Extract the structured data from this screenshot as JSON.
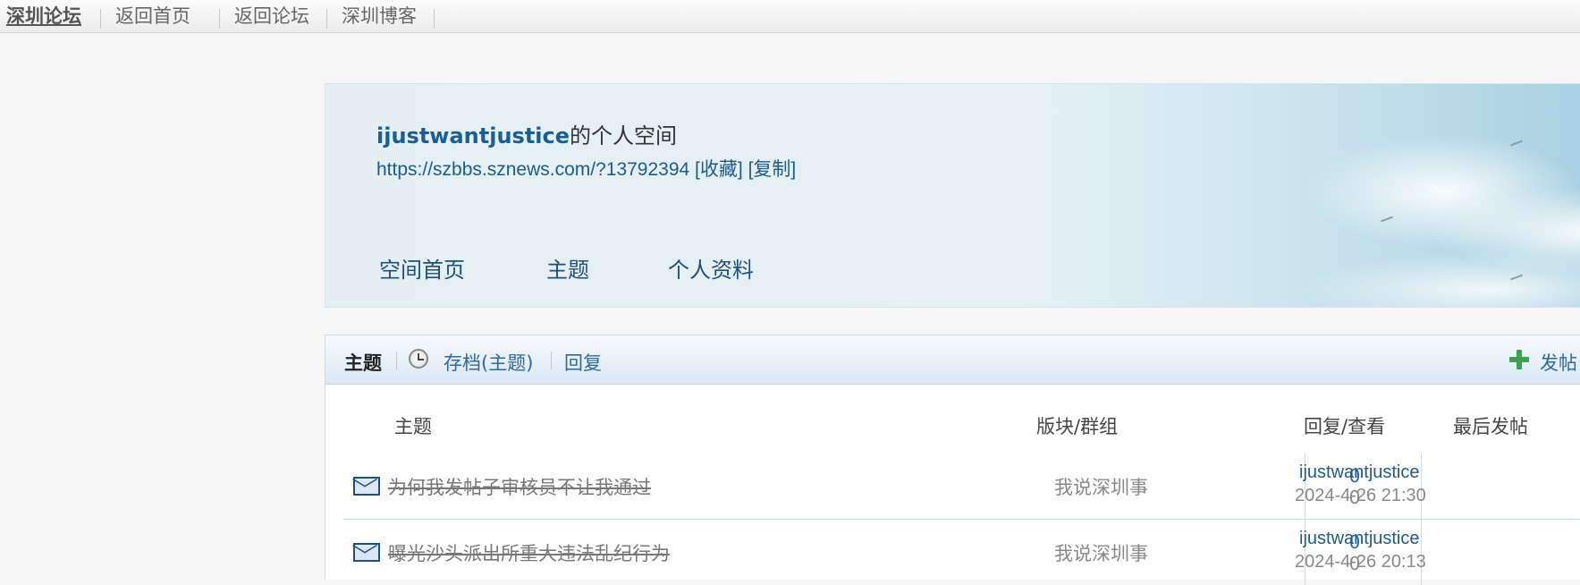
{
  "topnav": {
    "items": [
      "深圳论坛",
      "返回首页",
      "返回论坛",
      "深圳博客"
    ]
  },
  "space": {
    "username": "ijustwantjustice",
    "title_suffix": "的个人空间",
    "url": "https://szbbs.sznews.com/?13792394",
    "bookmark": "[收藏]",
    "copy": "[复制]",
    "nav": [
      "空间首页",
      "主题",
      "个人资料"
    ]
  },
  "threads": {
    "tabs": {
      "topics": "主题",
      "archive": "存档(主题)",
      "replies": "回复"
    },
    "post_button": "发帖",
    "columns": {
      "subject": "主题",
      "forum": "版块/群组",
      "stats": "回复/查看",
      "last": "最后发帖"
    },
    "rows": [
      {
        "subject": "为何我发帖子审核员不让我通过",
        "forum": "我说深圳事",
        "replies": "0",
        "views": "0",
        "last_user": "ijustwantjustice",
        "last_time": "2024-4-26 21:30"
      },
      {
        "subject": "曝光沙头派出所重大违法乱纪行为",
        "forum": "我说深圳事",
        "replies": "0",
        "views": "0",
        "last_user": "ijustwantjustice",
        "last_time": "2024-4-26 20:13"
      }
    ]
  },
  "icons": {
    "archive": "clock-icon",
    "post": "plus-icon",
    "thread": "envelope-icon"
  },
  "colors": {
    "link": "#2c6aa0",
    "accent_green": "#3aa24a",
    "banner_sky": "#a9d1e2"
  }
}
